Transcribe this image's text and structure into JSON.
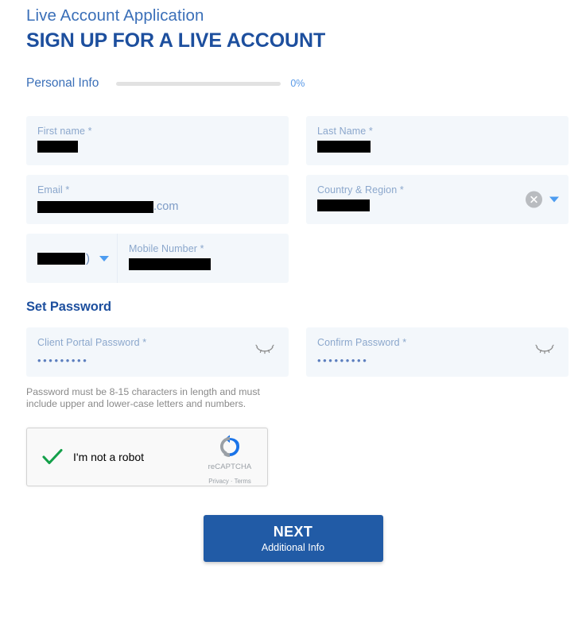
{
  "header": {
    "eyebrow": "Live Account Application",
    "title": "SIGN UP FOR A LIVE ACCOUNT"
  },
  "progress": {
    "step_label": "Personal Info",
    "percent_label": "0%",
    "percent_value": 0,
    "track_color": "#e2e2e2",
    "text_color": "#5a9ae8"
  },
  "fields": {
    "first_name": {
      "label": "First name *",
      "value": "",
      "redacted": true
    },
    "last_name": {
      "label": "Last Name *",
      "value": "",
      "redacted": true
    },
    "email": {
      "label": "Email *",
      "value": "",
      "redacted": true,
      "suffix": ".com"
    },
    "country_region": {
      "label": "Country & Region *",
      "value": "",
      "redacted": true,
      "clear_icon": "clear-circle-icon",
      "dropdown_icon": "chevron-down-icon"
    },
    "country_code": {
      "value": "",
      "redacted": true,
      "suffix": ")",
      "dropdown_icon": "chevron-down-icon"
    },
    "mobile_number": {
      "label": "Mobile Number *",
      "value": "",
      "redacted": true
    }
  },
  "password_section": {
    "title": "Set Password",
    "client_portal_password": {
      "label": "Client Portal Password *",
      "value": "•••••••••",
      "toggle_icon": "eye-closed-icon"
    },
    "confirm_password": {
      "label": "Confirm Password *",
      "value": "•••••••••",
      "toggle_icon": "eye-closed-icon"
    },
    "hint": "Password must be 8-15 characters in length and must include upper and lower-case letters and numbers."
  },
  "recaptcha": {
    "label": "I'm not a robot",
    "checked": true,
    "check_icon": "checkmark-icon",
    "brand": "reCAPTCHA",
    "privacy": "Privacy",
    "separator": "·",
    "terms": "Terms"
  },
  "next_button": {
    "main_label": "NEXT",
    "sub_label": "Additional Info",
    "color": "#215ba6"
  },
  "colors": {
    "brand_blue": "#1d4f9e",
    "accent_blue": "#4d9cf0",
    "field_bg": "#f3f7fb",
    "label_blue": "#8ba7cc"
  }
}
